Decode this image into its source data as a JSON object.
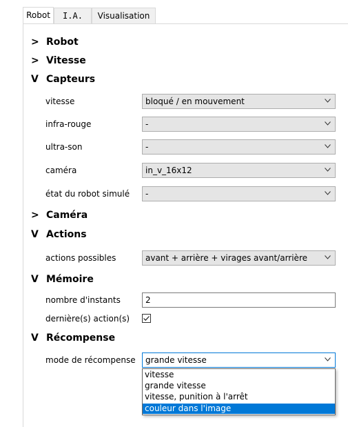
{
  "tabs": [
    {
      "label": "Robot",
      "active": true
    },
    {
      "label": "I.A.",
      "active": false
    },
    {
      "label": "Visualisation",
      "active": false
    }
  ],
  "sections": {
    "robot": {
      "arrow": ">",
      "title": "Robot"
    },
    "vitesse": {
      "arrow": ">",
      "title": "Vitesse"
    },
    "capteurs": {
      "arrow": "V",
      "title": "Capteurs"
    },
    "camera": {
      "arrow": ">",
      "title": "Caméra"
    },
    "actions": {
      "arrow": "V",
      "title": "Actions"
    },
    "memoire": {
      "arrow": "V",
      "title": "Mémoire"
    },
    "recompense": {
      "arrow": "V",
      "title": "Récompense"
    }
  },
  "capteurs": {
    "vitesse": {
      "label": "vitesse",
      "value": "bloqué / en mouvement"
    },
    "infra_rouge": {
      "label": "infra-rouge",
      "value": "-"
    },
    "ultra_son": {
      "label": "ultra-son",
      "value": "-"
    },
    "camera": {
      "label": "caméra",
      "value": "in_v_16x12"
    },
    "etat": {
      "label": "état du robot simulé",
      "value": "-"
    }
  },
  "actions": {
    "possibles": {
      "label": "actions possibles",
      "value": "avant + arrière + virages avant/arrière"
    }
  },
  "memoire": {
    "instants": {
      "label": "nombre d'instants",
      "value": "2"
    },
    "dernieres": {
      "label": "dernière(s) action(s)",
      "checked": true
    }
  },
  "recompense": {
    "mode": {
      "label": "mode de récompense",
      "value": "grande vitesse"
    },
    "options": [
      "vitesse",
      "grande vitesse",
      "vitesse, punition à l'arrêt",
      "couleur dans l'image"
    ],
    "highlighted_option": "couleur dans l'image"
  },
  "colors": {
    "accent": "#0078d7",
    "combo_bg": "#e5e5e5"
  },
  "icons": {
    "combo_arrow": "chevron-down-icon",
    "check": "checkmark-icon"
  }
}
